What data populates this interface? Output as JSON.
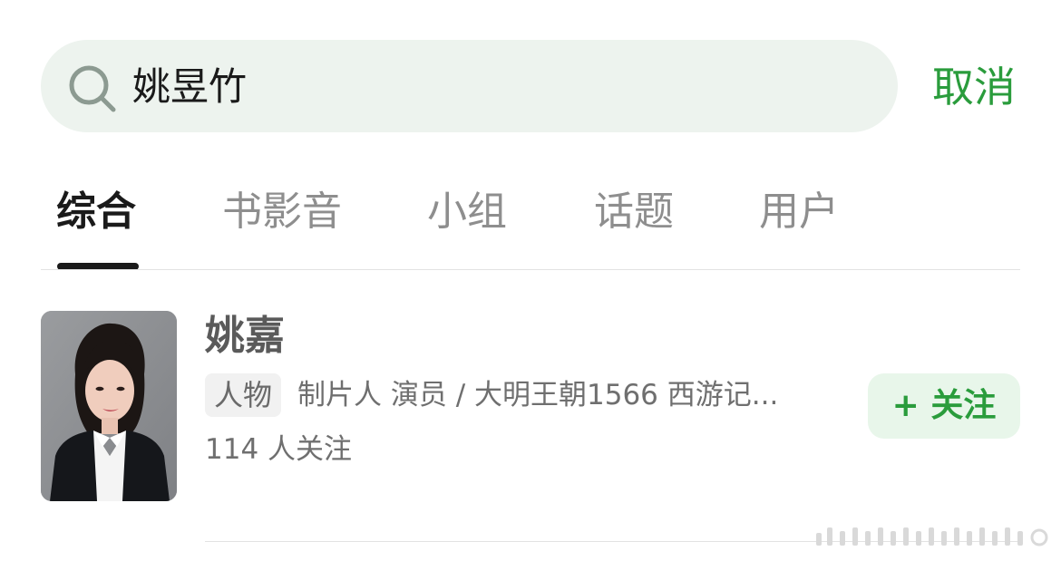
{
  "search": {
    "query": "姚昱竹",
    "cancel_label": "取消"
  },
  "tabs": [
    {
      "label": "综合",
      "active": true
    },
    {
      "label": "书影音",
      "active": false
    },
    {
      "label": "小组",
      "active": false
    },
    {
      "label": "话题",
      "active": false
    },
    {
      "label": "用户",
      "active": false
    }
  ],
  "result": {
    "name": "姚嘉",
    "tag": "人物",
    "description": "制片人 演员 / 大明王朝1566 西游记...",
    "followers": "114 人关注",
    "follow_label": "+ 关注"
  },
  "colors": {
    "accent": "#2a9c3c",
    "search_bg": "#edf3ee",
    "follow_bg": "#e8f6ea"
  }
}
